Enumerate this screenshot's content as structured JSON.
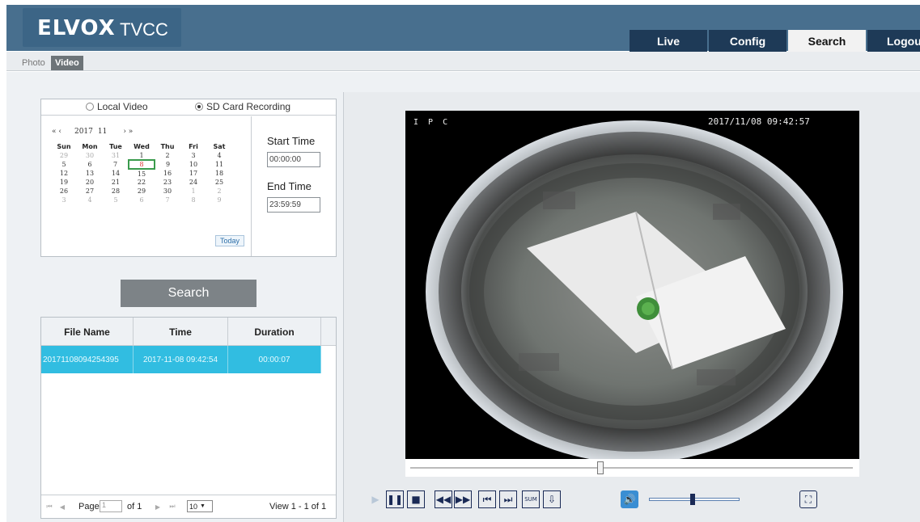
{
  "logo": {
    "brand": "ELVOX",
    "product": "TVCC"
  },
  "nav": {
    "tabs": [
      {
        "label": "Live"
      },
      {
        "label": "Config"
      },
      {
        "label": "Search",
        "active": true
      },
      {
        "label": "Logout"
      }
    ]
  },
  "subtabs": [
    {
      "label": "Photo"
    },
    {
      "label": "Video",
      "active": true
    }
  ],
  "source": {
    "local_label": "Local Video",
    "sd_label": "SD Card Recording",
    "selected": "SD Card Recording"
  },
  "calendar": {
    "nav_prev": "«  ‹",
    "year": "2017",
    "month": "11",
    "nav_next": "›  »",
    "weekdays": [
      "Sun",
      "Mon",
      "Tue",
      "Wed",
      "Thu",
      "Fri",
      "Sat"
    ],
    "weeks": [
      [
        "29",
        "30",
        "31",
        "1",
        "2",
        "3",
        "4"
      ],
      [
        "5",
        "6",
        "7",
        "8",
        "9",
        "10",
        "11"
      ],
      [
        "12",
        "13",
        "14",
        "15",
        "16",
        "17",
        "18"
      ],
      [
        "19",
        "20",
        "21",
        "22",
        "23",
        "24",
        "25"
      ],
      [
        "26",
        "27",
        "28",
        "29",
        "30",
        "1",
        "2"
      ],
      [
        "3",
        "4",
        "5",
        "6",
        "7",
        "8",
        "9"
      ]
    ],
    "selected_day": "8",
    "today_label": "Today"
  },
  "time": {
    "start_label": "Start Time",
    "start_value": "00:00:00",
    "end_label": "End Time",
    "end_value": "23:59:59"
  },
  "search_button": "Search",
  "file_list": {
    "columns": [
      "File Name",
      "Time",
      "Duration"
    ],
    "rows": [
      {
        "file_name": "20171108094254395",
        "time": "2017-11-08 09:42:54",
        "duration": "00:00:07",
        "selected": true
      }
    ],
    "pager": {
      "page_label": "Page",
      "page_value": "1",
      "of_label": "of 1",
      "page_size": "10",
      "view_text": "View 1 - 1 of 1"
    }
  },
  "video": {
    "osd_channel": "I P C",
    "osd_timestamp": "2017/11/08 09:42:57"
  },
  "playback": {
    "buttons": [
      "play-icon",
      "pause-icon",
      "stop-icon",
      "slow-icon",
      "fast-icon",
      "prev-frame-icon",
      "next-frame-icon",
      "sum-icon",
      "download-icon"
    ],
    "volume_level": 0.48,
    "seek_position": 0.43
  },
  "colors": {
    "header": "#486f8e",
    "nav_dark": "#1e3a57",
    "selected_row": "#31bde1",
    "accent": "#3a8ed3"
  }
}
